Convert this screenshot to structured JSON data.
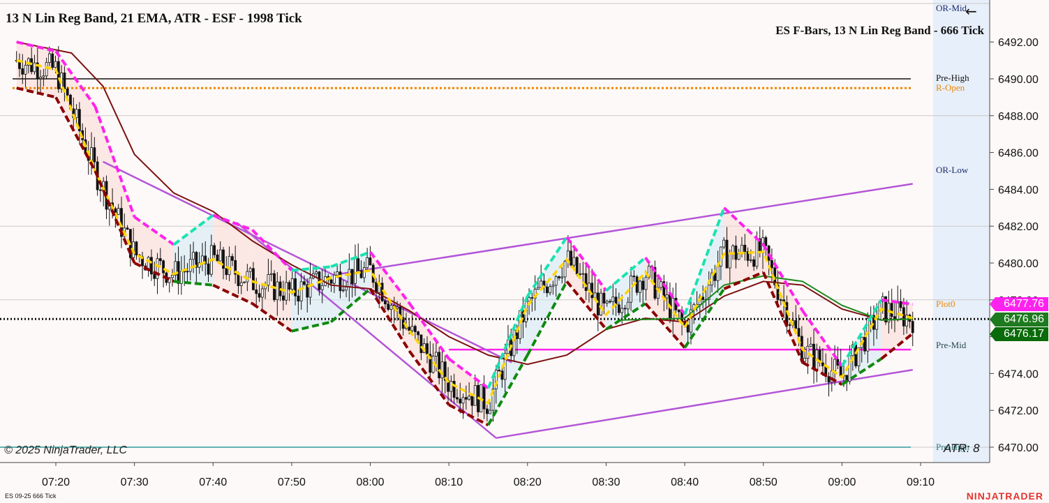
{
  "header": {
    "title": "13 N Lin Reg Band, 21 EMA, ATR - ESF - 1998 Tick",
    "subtitle": "ES F-Bars, 13 N Lin Reg Band - 666 Tick"
  },
  "footer": {
    "copyright": "© 2025 NinjaTrader, LLC",
    "atr_label": "ATR: 8",
    "instrument": "ES 09-25 666 Tick",
    "brand": "NINJATRADER"
  },
  "level_labels": {
    "or_mid": "OR-Mid",
    "pre_high": "Pre-High",
    "r_open": "R-Open",
    "or_low": "OR-Low",
    "plot0": "Plot0",
    "pre_mid": "Pre-Mid",
    "pre_low": "Pre-High"
  },
  "price_tags": [
    {
      "value": "6477.76",
      "color": "#ff22ee"
    },
    {
      "value": "6476.96",
      "color": "#1e7a1e"
    },
    {
      "value": "6476.17",
      "color": "#0a6b0a"
    }
  ],
  "colors": {
    "background": "#fdf9f8",
    "session_shade": "#e7effa",
    "ema": "#7b1010",
    "reg_channel": "#b455d8",
    "magenta": "#ff22ee",
    "yellow": "#ffd400",
    "green": "#0e8a0e",
    "cyan": "#19e3b0",
    "darkred": "#8b0000",
    "orange": "#ee8800"
  },
  "chart_data": {
    "type": "candlestick",
    "y_axis": {
      "min": 6469.4,
      "max": 6494.5,
      "ticks": [
        "6470.00",
        "6472.00",
        "6474.00",
        "6476.00",
        "6478.00",
        "6480.00",
        "6482.00",
        "6484.00",
        "6486.00",
        "6488.00",
        "6490.00",
        "6492.00"
      ]
    },
    "x_axis": {
      "ticks": [
        "07:20",
        "07:30",
        "07:40",
        "07:50",
        "08:00",
        "08:10",
        "08:20",
        "08:30",
        "08:40",
        "08:50",
        "09:00",
        "09:10"
      ]
    },
    "levels": [
      {
        "name": "Pre-High",
        "value": 6490.0,
        "style": "solid",
        "color": "#111111"
      },
      {
        "name": "R-Open",
        "value": 6489.5,
        "style": "dotted",
        "color": "#ee8800"
      },
      {
        "name": "Pre-Mid",
        "value": 6475.3,
        "style": "solid",
        "color": "#ff22ee"
      },
      {
        "name": "Last",
        "value": 6476.96,
        "style": "dotted",
        "color": "#111111"
      },
      {
        "name": "Pre-Low",
        "value": 6470.0,
        "style": "solid",
        "color": "#2e9a9a"
      }
    ],
    "regression_lines": [
      {
        "from": [
          "07:26",
          6485.5
        ],
        "to": [
          "08:18",
          6474.6
        ]
      },
      {
        "from": [
          "07:43",
          6482.2
        ],
        "to": [
          "08:16",
          6470.5
        ]
      },
      {
        "from": [
          "08:16",
          6470.5
        ],
        "to": [
          "09:09",
          6474.2
        ]
      },
      {
        "from": [
          "07:56",
          6479.4
        ],
        "to": [
          "09:09",
          6484.3
        ]
      }
    ],
    "series": [
      {
        "name": "21 EMA",
        "x": [
          "07:15",
          "07:22",
          "07:26",
          "07:30",
          "07:35",
          "07:40",
          "07:45",
          "07:50",
          "07:55",
          "08:00",
          "08:05",
          "08:10",
          "08:15",
          "08:20",
          "08:25",
          "08:30",
          "08:35",
          "08:40",
          "08:45",
          "08:50",
          "08:55",
          "09:00",
          "09:05",
          "09:09"
        ],
        "values": [
          6492.0,
          6491.4,
          6489.6,
          6485.9,
          6483.8,
          6482.8,
          6481.2,
          6479.9,
          6478.8,
          6478.6,
          6477.4,
          6476.0,
          6475.0,
          6474.5,
          6475.0,
          6476.4,
          6477.0,
          6476.8,
          6478.2,
          6479.0,
          6478.8,
          6477.5,
          6476.9,
          6476.96
        ]
      },
      {
        "name": "Lin Reg Mid",
        "x": [
          "07:15",
          "07:20",
          "07:25",
          "07:30",
          "07:35",
          "07:40",
          "07:45",
          "07:50",
          "07:55",
          "08:00",
          "08:05",
          "08:10",
          "08:15",
          "08:20",
          "08:25",
          "08:30",
          "08:35",
          "08:40",
          "08:45",
          "08:50",
          "08:55",
          "09:00",
          "09:05",
          "09:09"
        ],
        "values": [
          6491.0,
          6490.5,
          6485.0,
          6480.5,
          6479.4,
          6480.2,
          6479.0,
          6478.4,
          6479.2,
          6479.6,
          6476.3,
          6473.5,
          6472.4,
          6477.7,
          6480.2,
          6477.2,
          6479.5,
          6476.5,
          6480.5,
          6480.6,
          6475.3,
          6473.8,
          6477.5,
          6477.0
        ]
      },
      {
        "name": "Upper Band",
        "x": [
          "07:15",
          "07:20",
          "07:25",
          "07:30",
          "07:35",
          "07:40",
          "07:45",
          "07:50",
          "07:55",
          "08:00",
          "08:05",
          "08:10",
          "08:15",
          "08:20",
          "08:25",
          "08:30",
          "08:35",
          "08:40",
          "08:45",
          "08:50",
          "08:55",
          "09:00",
          "09:05",
          "09:09"
        ],
        "values": [
          6492.0,
          6491.5,
          6488.5,
          6482.5,
          6481.0,
          6482.6,
          6481.8,
          6479.6,
          6479.8,
          6480.6,
          6477.8,
          6474.8,
          6473.2,
          6478.2,
          6481.4,
          6478.5,
          6480.3,
          6477.2,
          6483.0,
          6481.0,
          6477.4,
          6474.4,
          6478.0,
          6477.76
        ]
      },
      {
        "name": "Lower Band",
        "x": [
          "07:15",
          "07:20",
          "07:25",
          "07:30",
          "07:35",
          "07:40",
          "07:45",
          "07:50",
          "07:55",
          "08:00",
          "08:05",
          "08:10",
          "08:15",
          "08:20",
          "08:25",
          "08:30",
          "08:35",
          "08:40",
          "08:45",
          "08:50",
          "08:55",
          "09:00",
          "09:05",
          "09:09"
        ],
        "values": [
          6489.5,
          6489.0,
          6485.0,
          6480.0,
          6479.0,
          6478.8,
          6477.8,
          6476.3,
          6476.8,
          6478.6,
          6475.2,
          6472.3,
          6471.2,
          6475.0,
          6479.0,
          6476.4,
          6477.8,
          6475.4,
          6478.6,
          6479.5,
          6474.6,
          6473.4,
          6474.8,
          6476.17
        ]
      },
      {
        "name": "Slow Reg",
        "x": [
          "08:32",
          "08:40",
          "08:45",
          "08:50",
          "08:55",
          "09:00",
          "09:05",
          "09:09"
        ],
        "values": [
          6476.9,
          6477.0,
          6478.8,
          6479.3,
          6479.0,
          6477.7,
          6476.9,
          6476.96
        ]
      }
    ],
    "candles_summary": {
      "open": 6489.8,
      "high": 6492.6,
      "low": 6470.5,
      "close": 6476.96,
      "first_time": "07:15",
      "last_time": "09:09"
    }
  }
}
